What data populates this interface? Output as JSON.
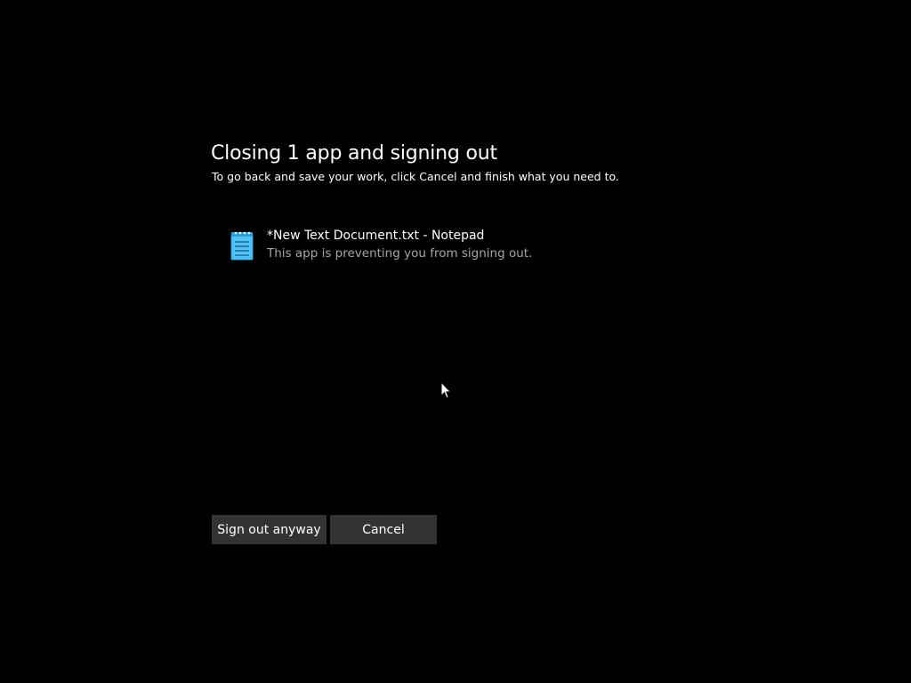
{
  "dialog": {
    "title": "Closing 1 app and signing out",
    "subtitle": "To go back and save your work, click Cancel and finish what you need to."
  },
  "apps": [
    {
      "icon": "notepad-icon",
      "name": "*New Text Document.txt - Notepad",
      "status": "This app is preventing you from signing out."
    }
  ],
  "buttons": {
    "sign_out_label": "Sign out anyway",
    "cancel_label": "Cancel"
  },
  "colors": {
    "background": "#000000",
    "text": "#ffffff",
    "secondary_text": "#a6a6a6",
    "button_bg": "#333333",
    "notepad_icon": "#4fc3f7"
  }
}
